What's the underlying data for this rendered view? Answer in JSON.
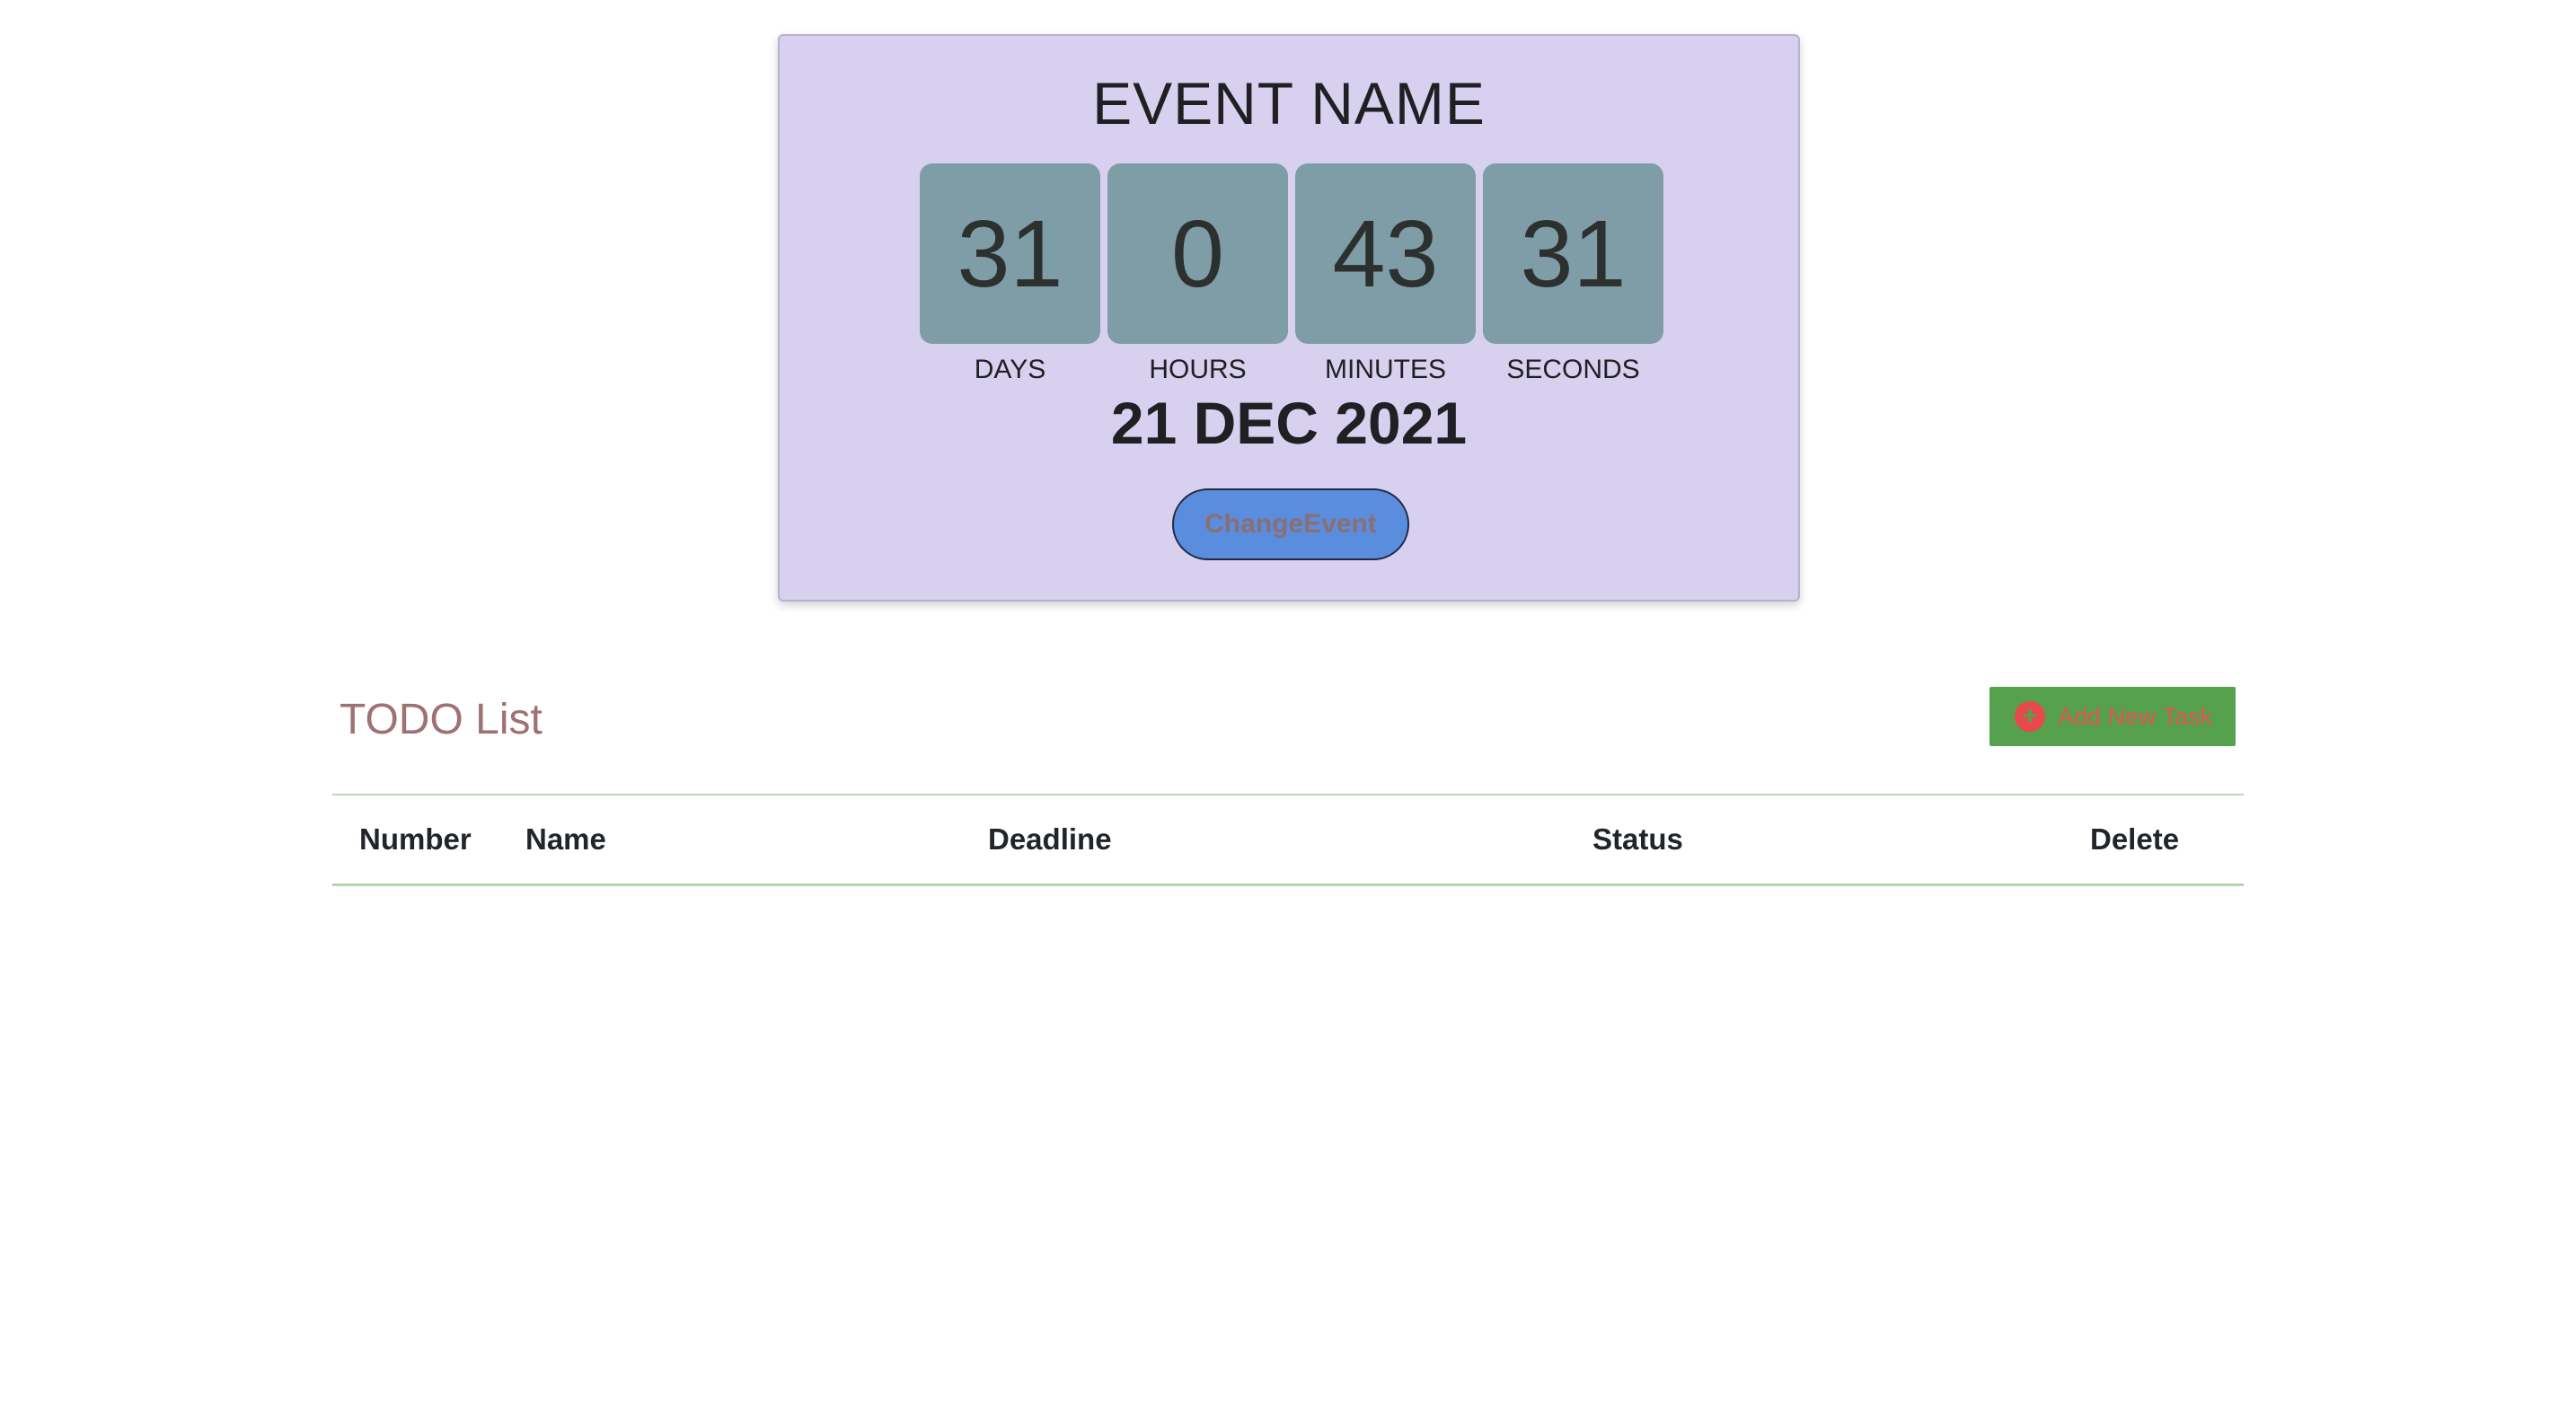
{
  "event": {
    "name": "EVENT NAME",
    "countdown": [
      {
        "value": "31",
        "label": "DAYS"
      },
      {
        "value": "0",
        "label": "HOURS"
      },
      {
        "value": "43",
        "label": "MINUTES"
      },
      {
        "value": "31",
        "label": "SECONDS"
      }
    ],
    "date": "21 DEC 2021",
    "change_button": "ChangeEvent"
  },
  "todo": {
    "title": "TODO List",
    "add_button": "Add New Task",
    "add_icon": "plus-circle-icon",
    "columns": [
      "Number",
      "Name",
      "Deadline",
      "Status",
      "Delete"
    ],
    "rows": []
  },
  "colors": {
    "card_background": "#d8d0ef",
    "countdown_box": "#7e9da7",
    "change_button": "#5b8ddf",
    "add_button": "#56a14d",
    "todo_title": "#a07173",
    "table_border": "#b5d7ae"
  }
}
